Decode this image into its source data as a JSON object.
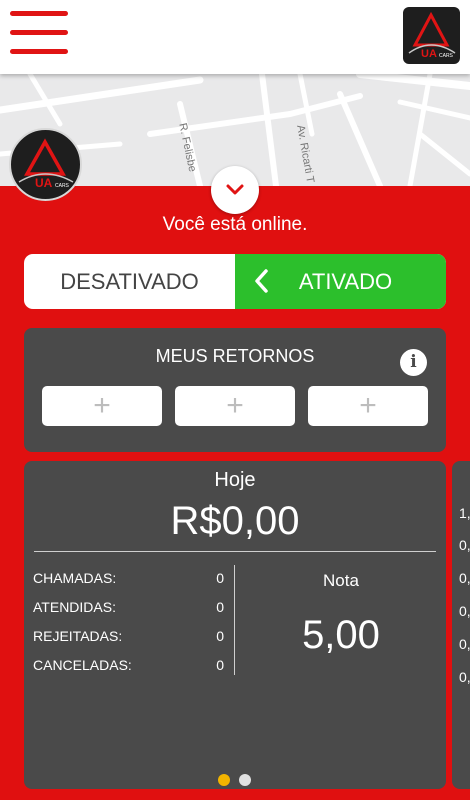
{
  "map": {
    "street_1": "R. Felisbe",
    "street_2": "Av. Ricarti T"
  },
  "logo": {
    "text": "UA",
    "subtext": "CARS"
  },
  "status": {
    "online_text": "Você está online."
  },
  "toggle": {
    "off_label": "DESATIVADO",
    "on_label": "ATIVADO",
    "state": "on",
    "on_color": "#2cbf2c"
  },
  "retornos": {
    "title": "MEUS RETORNOS",
    "info_icon": "i",
    "slots": [
      "+",
      "+",
      "+"
    ]
  },
  "today": {
    "title": "Hoje",
    "amount": "R$0,00",
    "stats": [
      {
        "label": "CHAMADAS:",
        "value": "0"
      },
      {
        "label": "ATENDIDAS:",
        "value": "0"
      },
      {
        "label": "REJEITADAS:",
        "value": "0"
      },
      {
        "label": "CANCELADAS:",
        "value": "0"
      }
    ],
    "nota_label": "Nota",
    "nota_value": "5,00"
  },
  "next_card_peek": [
    "1,",
    "0,",
    "0,",
    "0,",
    "0,",
    "0,"
  ],
  "pager": {
    "count": 2,
    "active_index": 0,
    "active_color": "#f2b400",
    "inactive_color": "#e0e0e0"
  },
  "colors": {
    "brand_red": "#e01010",
    "card_gray": "#4a4a4a"
  }
}
